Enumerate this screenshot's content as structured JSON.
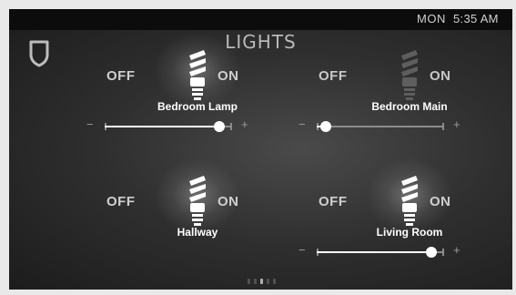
{
  "status": {
    "day": "MON",
    "time": "5:35 AM"
  },
  "title": "LIGHTS",
  "lights": [
    {
      "name": "Bedroom Lamp",
      "off_label": "OFF",
      "on_label": "ON",
      "state": "on",
      "dimmer": {
        "minus": "−",
        "plus": "+",
        "level": 0.9
      }
    },
    {
      "name": "Bedroom Main",
      "off_label": "OFF",
      "on_label": "ON",
      "state": "off",
      "dimmer": {
        "minus": "−",
        "plus": "+",
        "level": 0.07
      }
    },
    {
      "name": "Hallway",
      "off_label": "OFF",
      "on_label": "ON",
      "state": "on"
    },
    {
      "name": "Living Room",
      "off_label": "OFF",
      "on_label": "ON",
      "state": "on",
      "dimmer": {
        "minus": "−",
        "plus": "+",
        "level": 0.9
      }
    }
  ],
  "pager": {
    "count": 5,
    "active": 2
  },
  "colors": {
    "bulb_on": "#ffffff",
    "bulb_off": "#5e5e5e",
    "background": "#2f2f2f"
  },
  "icons": {
    "home": "shield-icon",
    "bulb": "cfl-bulb-icon"
  }
}
